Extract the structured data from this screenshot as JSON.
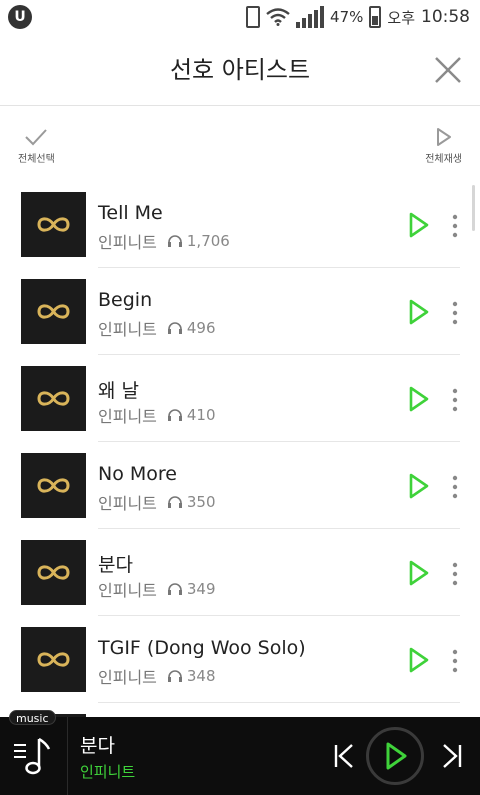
{
  "status_bar": {
    "app_badge": "U",
    "battery_percent": "47%",
    "ampm": "오후",
    "time": "10:58"
  },
  "header": {
    "title": "선호 아티스트"
  },
  "actions": {
    "select_all": "전체선택",
    "play_all": "전체재생"
  },
  "tracks": [
    {
      "title": "Tell Me",
      "artist": "인피니트",
      "listens": "1,706"
    },
    {
      "title": "Begin",
      "artist": "인피니트",
      "listens": "496"
    },
    {
      "title": "왜 날",
      "artist": "인피니트",
      "listens": "410"
    },
    {
      "title": "No More",
      "artist": "인피니트",
      "listens": "350"
    },
    {
      "title": "분다",
      "artist": "인피니트",
      "listens": "349"
    },
    {
      "title": "TGIF (Dong Woo Solo)",
      "artist": "인피니트",
      "listens": "348"
    }
  ],
  "player": {
    "badge": "music",
    "title": "분다",
    "artist": "인피니트"
  },
  "colors": {
    "accent": "#3fd23a",
    "logo_gold": "#d9b45a",
    "player_bg": "#0d0d0d"
  },
  "icons": {
    "close": "close-icon",
    "check": "check-icon",
    "play": "play-icon",
    "more": "more-vertical-icon",
    "headphones": "headphones-icon",
    "queue": "music-queue-icon",
    "prev": "skip-previous-icon",
    "next": "skip-next-icon"
  }
}
